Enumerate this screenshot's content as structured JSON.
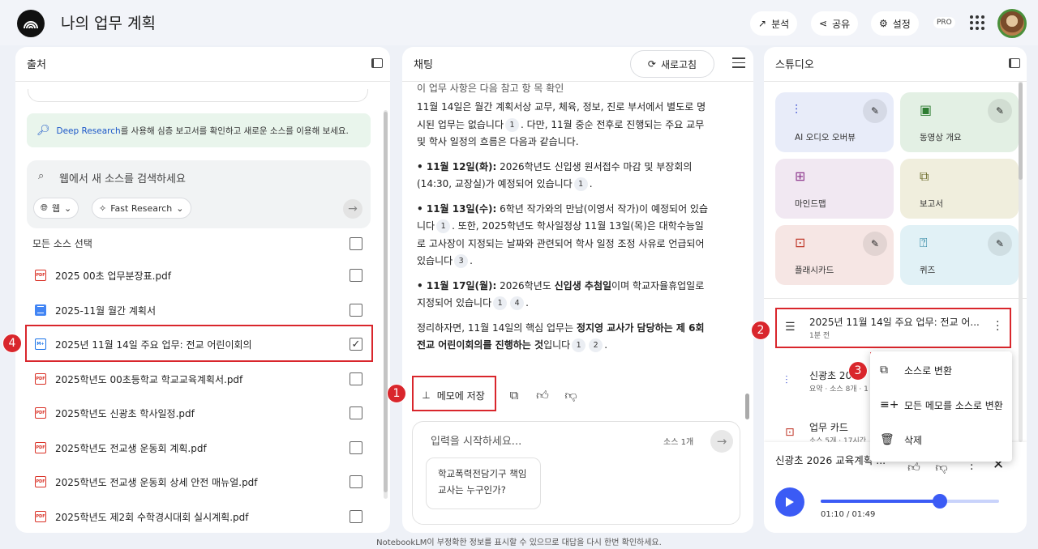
{
  "header": {
    "title": "나의 업무 계획",
    "analyze_label": "분석",
    "share_label": "공유",
    "settings_label": "설정",
    "pro_badge": "PRO"
  },
  "sources": {
    "title": "출처",
    "deep_research_link": "Deep Research",
    "deep_research_text": "를 사용해 심층 보고서를 확인하고 새로운 소스를 이용해 보세요.",
    "search_placeholder": "웹에서 새 소스를 검색하세요",
    "web_chip": "웹",
    "research_chip": "Fast Research",
    "select_all": "모든 소스 선택",
    "items": [
      {
        "name": "2025 00초 업무분장표.pdf",
        "type": "pdf",
        "checked": false
      },
      {
        "name": "2025-11월 월간 계획서",
        "type": "doc",
        "checked": false
      },
      {
        "name": "2025년 11월 14일 주요 업무: 전교 어린이회의",
        "type": "memo",
        "checked": true
      },
      {
        "name": "2025학년도 00초등학교 학교교육계획서.pdf",
        "type": "pdf",
        "checked": false
      },
      {
        "name": "2025학년도 신광초 학사일정.pdf",
        "type": "pdf",
        "checked": false
      },
      {
        "name": "2025학년도 전교생 운동회 계획.pdf",
        "type": "pdf",
        "checked": false
      },
      {
        "name": "2025학년도 전교생 운동회 상세 안전 매뉴얼.pdf",
        "type": "pdf",
        "checked": false
      },
      {
        "name": "2025학년도 제2회 수학경시대회 실시계획.pdf",
        "type": "pdf",
        "checked": false
      }
    ]
  },
  "chat": {
    "title": "채팅",
    "refresh_label": "새로고침",
    "cut_text": "이 업무 사항은 다음 참고 항 목 확인",
    "p1_a": "11월 14일은 월간 계획서상 교무, 체육, 정보, 진로 부서에서 별도로 명시된 업무는 없습니다",
    "p1_b": ". 다만, 11월 중순 전후로 진행되는 주요 교무 및 학사 일정의 흐름은 다음과 같습니다.",
    "b1_head": "• 11월 12일(화):",
    "b1_text": " 2026학년도 신입생 원서접수 마감 및 부장회의 (14:30, 교장실)가 예정되어 있습니다",
    "b2_head": "• 11월 13일(수):",
    "b2_text_a": " 6학년 작가와의 만남(이영서 작가)이 예정되어 있습니다",
    "b2_text_b": ". 또한, 2025학년도 학사일정상 11월 13일(목)은 대학수능일로 고사장이 지정되는 날짜와 관련되어 학사 일정 조정 사유로 언급되어 있습니다",
    "b3_head": "• 11월 17일(월):",
    "b3_text_a": " 2026학년도 ",
    "b3_bold": "신입생 추첨일",
    "b3_text_b": "이며 학교자율휴업일로 지정되어 있습니다",
    "sum_a": "정리하자면, 11월 14일의 핵심 업무는 ",
    "sum_bold": "정지영 교사가 담당하는 제 6회 전교 어린이회의를 진행하는 것",
    "sum_b": "입니다",
    "cite1": "1",
    "cite2": "2",
    "cite3": "3",
    "cite4": "4",
    "save_label": "메모에 저장",
    "input_placeholder": "입력을 시작하세요...",
    "source_count": "소스 1개",
    "suggestion": "학교폭력전담기구 책임교사는 누구인가?"
  },
  "studio": {
    "title": "스튜디오",
    "tiles": [
      {
        "label": "AI 오디오 오버뷰",
        "icon": "audio-icon",
        "color": "#e8ecf9",
        "icon_color": "#4a5bd4"
      },
      {
        "label": "동영상 개요",
        "icon": "video-icon",
        "color": "#e3f0e4",
        "icon_color": "#2e7d32"
      },
      {
        "label": "마인드맵",
        "icon": "mindmap-icon",
        "color": "#f1e8f2",
        "icon_color": "#8e3a8e"
      },
      {
        "label": "보고서",
        "icon": "report-icon",
        "color": "#f0eedd",
        "icon_color": "#6b6b2a"
      },
      {
        "label": "플래시카드",
        "icon": "flashcard-icon",
        "color": "#f6e6e4",
        "icon_color": "#c0392b"
      },
      {
        "label": "퀴즈",
        "icon": "quiz-icon",
        "color": "#e1f1f6",
        "icon_color": "#1a7b9a"
      }
    ],
    "notes": [
      {
        "title": "2025년 11월 14일 주요 업무: 전교 어...",
        "sub": "1분 전"
      },
      {
        "title": "신광초 2026",
        "sub": "요약 · 소스 8개 · 1"
      },
      {
        "title": "업무 카드",
        "sub": "소스 5개 · 17시간"
      }
    ],
    "menu": [
      {
        "label": "소스로 변환",
        "icon": "convert-icon"
      },
      {
        "label": "모든 메모를 소스로 변환",
        "icon": "convert-all-icon"
      },
      {
        "label": "삭제",
        "icon": "trash-icon"
      }
    ],
    "player": {
      "title": "신광초 2026 교육계획 ...",
      "time": "01:10 / 01:49",
      "progress": 0.67
    }
  },
  "annotations": [
    "1",
    "2",
    "3",
    "4"
  ],
  "footer": "NotebookLM이 부정확한 정보를 표시할 수 있으므로 대답을 다시 한번 확인하세요.",
  "colors": {
    "accent": "#3b5bf5",
    "highlight": "#d9262c"
  }
}
